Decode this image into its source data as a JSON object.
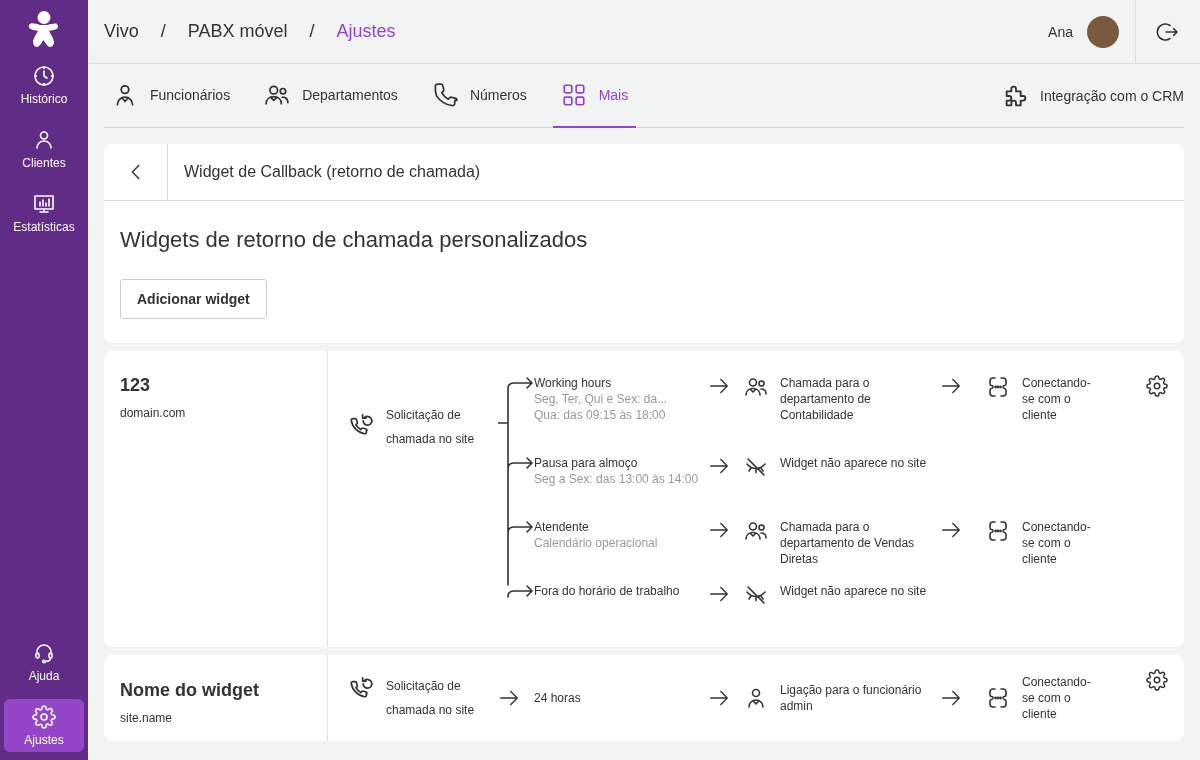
{
  "sidebar": {
    "top": [
      {
        "label": "Histórico",
        "kind": "history",
        "selected": false
      },
      {
        "label": "Clientes",
        "kind": "clients",
        "selected": false
      },
      {
        "label": "Estatísticas",
        "kind": "stats",
        "selected": false
      }
    ],
    "bottom": [
      {
        "label": "Ajuda",
        "kind": "help",
        "selected": false
      },
      {
        "label": "Ajustes",
        "kind": "settings",
        "selected": true
      }
    ]
  },
  "breadcrumb": {
    "items": [
      {
        "label": "Vivo",
        "current": false
      },
      {
        "label": "PABX móvel",
        "current": false
      },
      {
        "label": "Ajustes",
        "current": true
      }
    ],
    "separators": [
      "/",
      "/"
    ]
  },
  "user": {
    "name": "Ana"
  },
  "tabs": [
    {
      "label": "Funcionários",
      "kind": "person",
      "selected": false
    },
    {
      "label": "Departamentos",
      "kind": "people",
      "selected": false
    },
    {
      "label": "Números",
      "kind": "phone",
      "selected": false
    },
    {
      "label": "Mais",
      "kind": "grid",
      "selected": true
    }
  ],
  "crm_link": {
    "label": "Integração com o CRM"
  },
  "panel": {
    "title": "Widget de Callback (retorno de chamada)",
    "heading": "Widgets de retorno de chamada personalizados",
    "add_button": "Adicionar widget"
  },
  "widgets": [
    {
      "name": "123",
      "domain": "domain.com",
      "trigger": "Solicitação de chamada no site",
      "branches": [
        {
          "title": "Working hours",
          "details": [
            "Seg, Ter, Qui e Sex: da...",
            "Qua: das 09:15 às 18:00"
          ],
          "action": {
            "kind": "department",
            "label": "Chamada para o departamento de Contabilidade"
          },
          "result": {
            "kind": "connect",
            "label": "Conectando-se com o cliente"
          }
        },
        {
          "title": "Pausa para almoço",
          "details": [
            "Seg a Sex: das 13:00 às 14:00"
          ],
          "action": {
            "kind": "hidden",
            "label": "Widget não aparece no site"
          }
        },
        {
          "title": "Atendente",
          "details": [
            "Calendário operacional"
          ],
          "action": {
            "kind": "department",
            "label": "Chamada para o departamento de Vendas Diretas"
          },
          "result": {
            "kind": "connect",
            "label": "Conectando-se com o cliente"
          }
        },
        {
          "title": "Fora do horário de trabalho",
          "action": {
            "kind": "hidden",
            "label": "Widget não aparece no site"
          }
        }
      ]
    },
    {
      "name": "Nome do widget",
      "domain": "site.name",
      "trigger": "Solicitação de chamada no site",
      "branches": [
        {
          "title": "24 horas",
          "action": {
            "kind": "employee",
            "label": "Ligação para o funcionário admin"
          },
          "result": {
            "kind": "connect",
            "label": "Conectando-se com o cliente"
          }
        }
      ]
    }
  ]
}
